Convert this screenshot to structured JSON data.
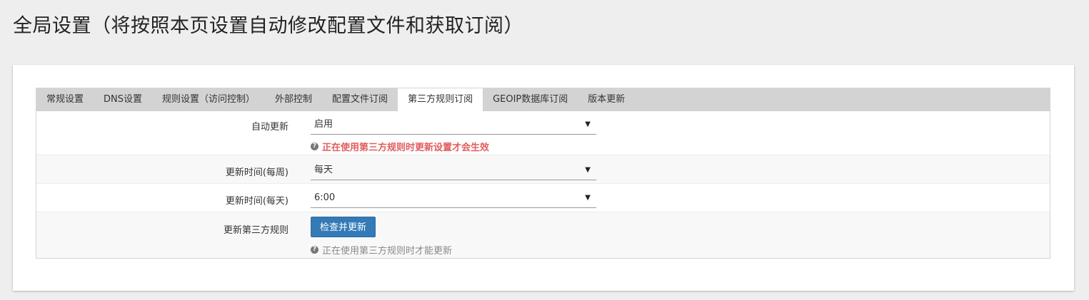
{
  "page": {
    "title": "全局设置（将按照本页设置自动修改配置文件和获取订阅）"
  },
  "tabs": [
    {
      "label": "常规设置"
    },
    {
      "label": "DNS设置"
    },
    {
      "label": "规则设置（访问控制）"
    },
    {
      "label": "外部控制"
    },
    {
      "label": "配置文件订阅"
    },
    {
      "label": "第三方规则订阅"
    },
    {
      "label": "GEOIP数据库订阅"
    },
    {
      "label": "版本更新"
    }
  ],
  "active_tab": "第三方规则订阅",
  "form": {
    "auto_update": {
      "label": "自动更新",
      "value": "启用",
      "hint": "正在使用第三方规则时更新设置才会生效"
    },
    "update_week": {
      "label": "更新时间(每周)",
      "value": "每天"
    },
    "update_day": {
      "label": "更新时间(每天)",
      "value": "6:00"
    },
    "update_rules": {
      "label": "更新第三方规则",
      "button": "检查并更新",
      "hint": "正在使用第三方规则时才能更新"
    }
  },
  "icons": {
    "caret": "caret-down-icon",
    "help": "question-circle-icon"
  },
  "colors": {
    "button": "#337ab7",
    "warning_hint": "#e25d5d",
    "tab_bar": "#d3d3d3"
  }
}
